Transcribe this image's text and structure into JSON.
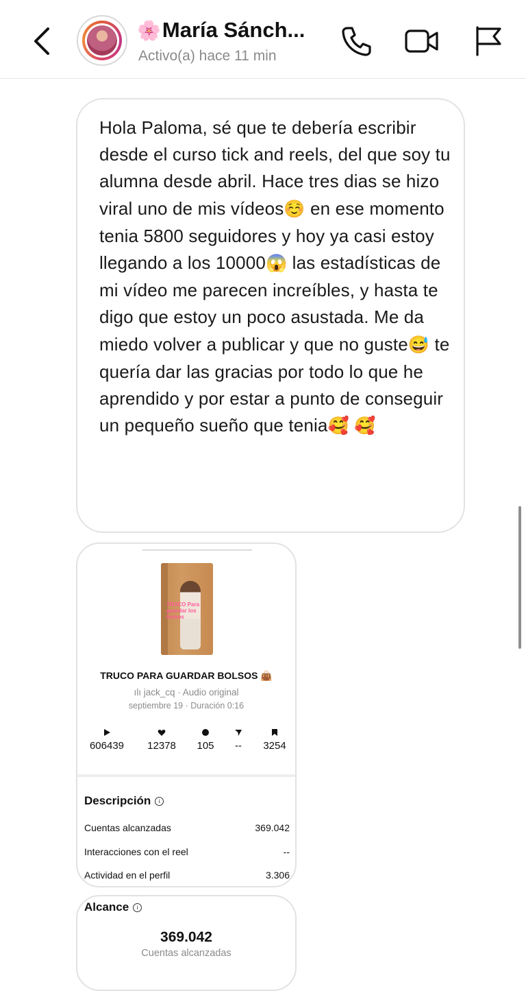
{
  "header": {
    "back_icon": "chevron-left-icon",
    "name_emoji": "🌸",
    "name": "María Sánch...",
    "status": "Activo(a) hace 11 min",
    "call_icon": "phone-icon",
    "video_icon": "video-camera-icon",
    "report_icon": "flag-icon"
  },
  "message": {
    "text_parts": [
      "Hola Paloma, sé que te debería escribir desde el curso tick and reels, del que soy tu alumna desde abril. Hace tres dias se hizo viral uno de mis vídeos",
      "☺️",
      " en ese momento tenia 5800 seguidores y hoy ya casi estoy llegando a los 10000",
      "😱",
      " las estadísticas de mi vídeo me parecen increíbles, y hasta te digo que estoy un poco asustada. Me da miedo volver a publicar y que no guste",
      "😅",
      " te quería dar las gracias por todo lo que he aprendido y por estar a punto de conseguir un pequeño sueño que tenia",
      "🥰",
      " ",
      "🥰"
    ]
  },
  "reel_card": {
    "thumbnail_text": "TRUCO Para guardar los bolsos",
    "title": "TRUCO PARA GUARDAR BOLSOS 👜",
    "audio": "ılı jack_cq · Audio original",
    "date": "septiembre 19 · Duración 0:16",
    "stats": [
      {
        "icon": "play-icon",
        "glyph": "▶",
        "value": "606439"
      },
      {
        "icon": "heart-icon",
        "glyph": "❤",
        "value": "12378"
      },
      {
        "icon": "comment-icon",
        "glyph": "●",
        "value": "105"
      },
      {
        "icon": "share-icon",
        "glyph": "➤",
        "value": "--"
      },
      {
        "icon": "bookmark-icon",
        "glyph": "▮",
        "value": "3254"
      }
    ],
    "description_title": "Descripción",
    "rows": [
      {
        "label": "Cuentas alcanzadas",
        "value": "369.042"
      },
      {
        "label": "Interacciones con el reel",
        "value": "--"
      },
      {
        "label": "Actividad en el perfil",
        "value": "3.306"
      }
    ]
  },
  "reach_card": {
    "title": "Alcance",
    "number": "369.042",
    "label": "Cuentas alcanzadas"
  }
}
